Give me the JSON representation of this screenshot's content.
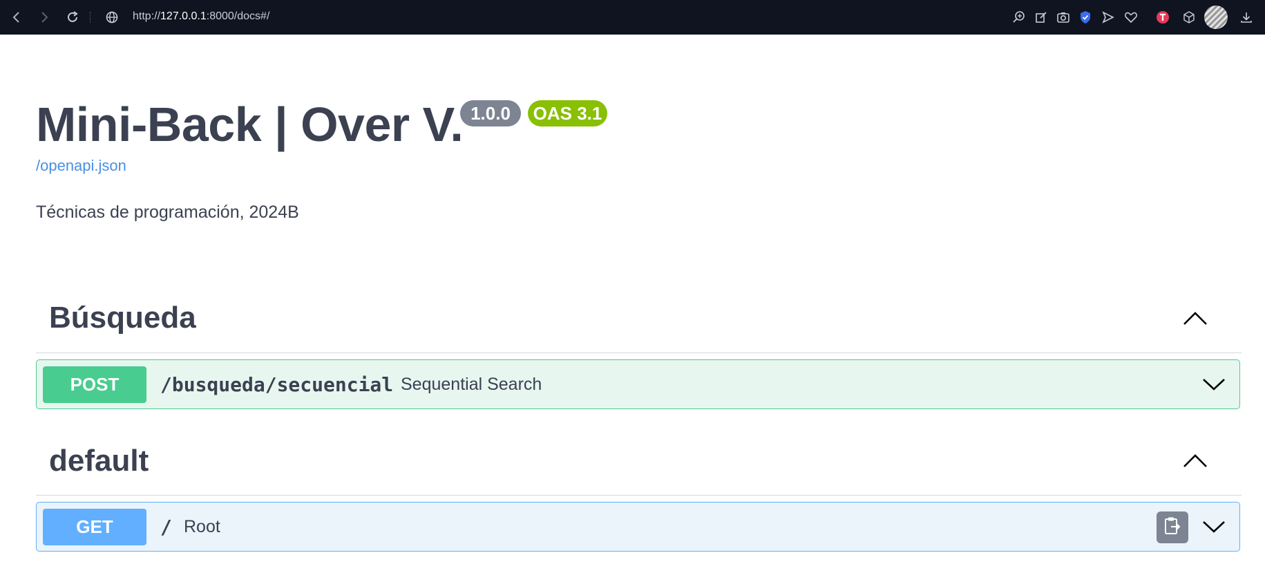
{
  "browser": {
    "url_prefix": "http://",
    "url_host": "127.0.0.1",
    "url_rest": ":8000/docs#/"
  },
  "header": {
    "title": "Mini-Back | Over V.",
    "version": "1.0.0",
    "oas": "OAS 3.1",
    "spec_link": "/openapi.json",
    "description": "Técnicas de programación, 2024B"
  },
  "sections": [
    {
      "name": "Búsqueda",
      "operations": [
        {
          "method": "POST",
          "path": "/busqueda/secuencial",
          "summary": "Sequential Search"
        }
      ]
    },
    {
      "name": "default",
      "operations": [
        {
          "method": "GET",
          "path": "/",
          "summary": "Root"
        }
      ]
    }
  ],
  "colors": {
    "post": "#49cc90",
    "get": "#61affe",
    "text": "#3b4151",
    "link": "#4990e2",
    "oas_badge": "#89bf04",
    "version_badge": "#7d8492"
  },
  "icons": [
    "back-icon",
    "forward-icon",
    "reload-icon",
    "globe-icon",
    "zoom-icon",
    "edit-icon",
    "camera-icon",
    "shield-icon",
    "send-icon",
    "heart-icon",
    "extension-icon",
    "cube-icon",
    "avatar",
    "download-icon",
    "chevron-up-icon",
    "chevron-down-icon",
    "clipboard-icon"
  ]
}
